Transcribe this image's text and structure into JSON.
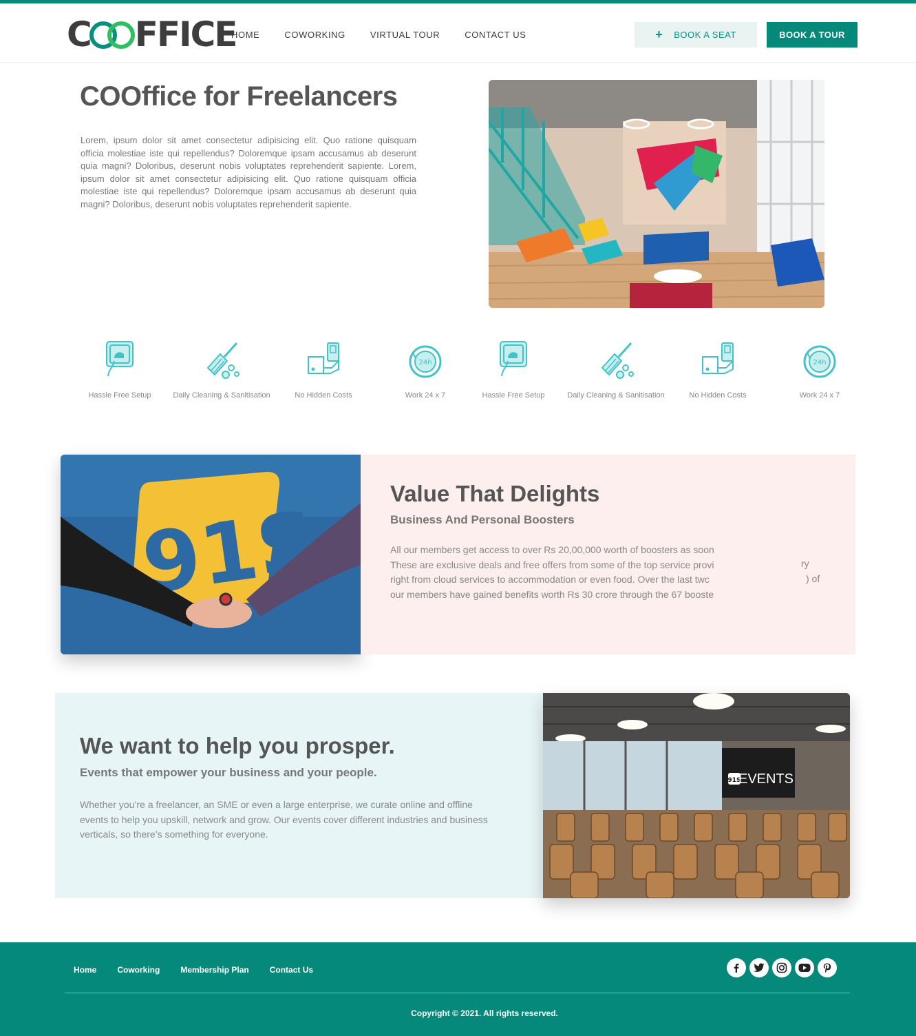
{
  "header": {
    "logo_text": "COOFFICE",
    "nav": [
      "HOME",
      "COWORKING",
      "VIRTUAL TOUR",
      "CONTACT US"
    ],
    "book_seat_label": "BOOK A SEAT",
    "book_tour_label": "BOOK A TOUR"
  },
  "hero": {
    "title": "COOffice for Freelancers",
    "text": "Lorem, ipsum dolor sit amet consectetur adipisicing elit. Quo ratione quisquam officia molestiae iste qui repellendus? Doloremque ipsam accusamus ab deserunt quia magni? Doloribus, deserunt nobis voluptates reprehenderit sapiente. Lorem, ipsum dolor sit amet consectetur adipisicing elit. Quo ratione quisquam officia molestiae iste qui repellendus? Doloremque ipsam accusamus ab deserunt quia magni? Doloribus, deserunt nobis voluptates reprehenderit sapiente."
  },
  "features": [
    {
      "label": "Hassle Free Setup",
      "icon": "plug-icon"
    },
    {
      "label": "Daily Cleaning & Sanitisation",
      "icon": "broom-icon"
    },
    {
      "label": "No Hidden Costs",
      "icon": "hand-wallet-icon"
    },
    {
      "label": "Work 24 x 7",
      "icon": "clock-24h-icon"
    },
    {
      "label": "Hassle Free Setup",
      "icon": "plug-icon"
    },
    {
      "label": "Daily Cleaning & Sanitisation",
      "icon": "broom-icon"
    },
    {
      "label": "No Hidden Costs",
      "icon": "hand-wallet-icon"
    },
    {
      "label": "Work 24 x 7",
      "icon": "clock-24h-icon"
    }
  ],
  "value": {
    "title": "Value That Delights",
    "subtitle": "Business And Personal Boosters",
    "lines": [
      "All our members get access to over Rs 20,00,000 worth of boosters as soon",
      "These are exclusive deals and free offers from some of the top service provi",
      "right from cloud services to accommodation or even food. Over the last twc",
      "our members have gained benefits worth Rs 30 crore through the 67 booste"
    ],
    "fragment_1": "ry",
    "fragment_2": ") of"
  },
  "prosper": {
    "title": "We want to help you prosper.",
    "subtitle": "Events that empower your business and your people.",
    "text": "Whether you’re a freelancer, an SME or even a large enterprise, we curate online and offline events to help you upskill, network and grow. Our events cover different industries and business verticals, so there’s something for everyone.",
    "screen_text": "EVENTS",
    "screen_badge": "91S"
  },
  "footer": {
    "nav": [
      "Home",
      "Coworking",
      "Membership Plan",
      "Contact Us"
    ],
    "socials": [
      "facebook-icon",
      "twitter-icon",
      "instagram-icon",
      "youtube-icon",
      "pinterest-icon"
    ],
    "copyright": "Copyright © 2021. All rights reserved."
  },
  "colors": {
    "brand": "#05897a",
    "accent_light": "#e9f3f1",
    "icon": "#3fc4c9",
    "pink_panel": "#fcefed",
    "mint_panel": "#e8f5f7"
  }
}
